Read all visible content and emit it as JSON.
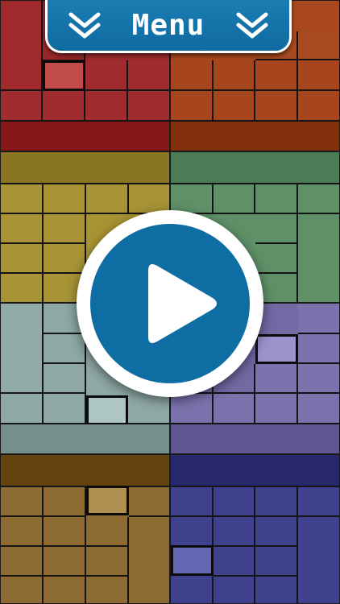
{
  "menu": {
    "label": "Menu",
    "icon_left": "double-chevron-down-icon",
    "icon_right": "double-chevron-down-icon"
  },
  "play": {
    "icon": "play-icon",
    "color": "#0e6ea4"
  },
  "palette": {
    "red": "#9e2b2e",
    "orange": "#a9481f",
    "olive": "#a99434",
    "green": "#5f9168",
    "slate": "#8ea8a5",
    "purple": "#7369a5",
    "brown": "#8b6930",
    "navy": "#3d3f8a"
  }
}
